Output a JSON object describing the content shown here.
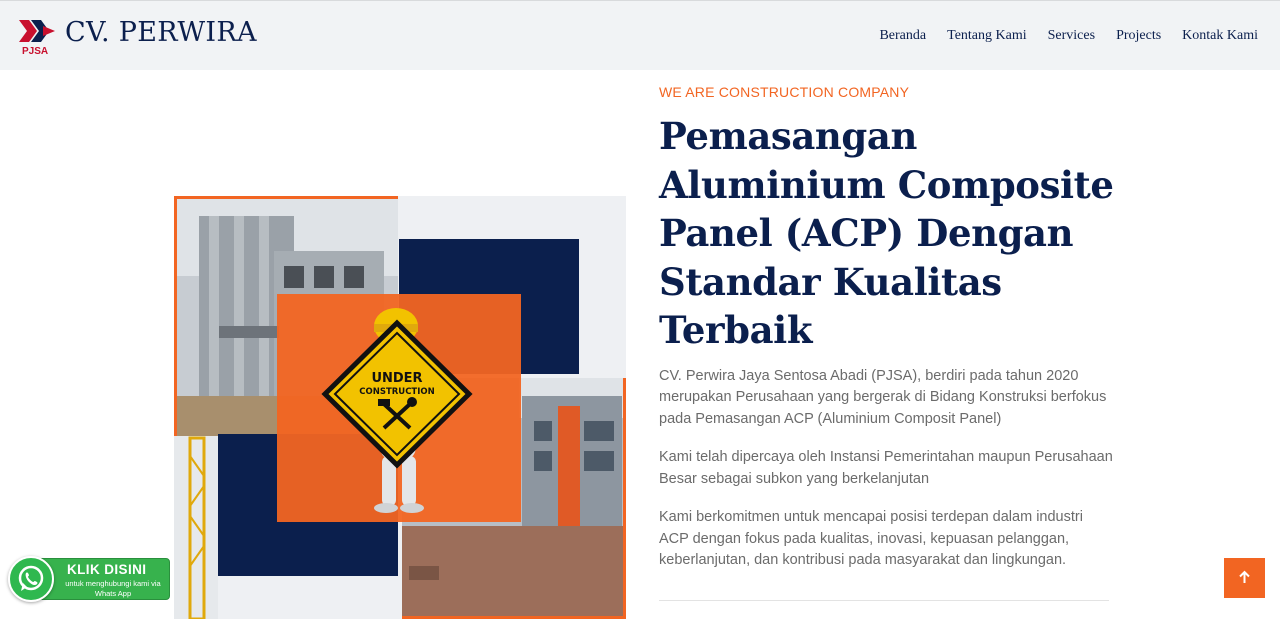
{
  "brand": {
    "logo_label": "PJSA",
    "name": "CV. PERWIRA"
  },
  "nav": {
    "items": [
      "Beranda",
      "Tentang Kami",
      "Services",
      "Projects",
      "Kontak Kami"
    ]
  },
  "hero": {
    "eyebrow": "WE ARE CONSTRUCTION COMPANY",
    "headline": "Pemasangan Aluminium Composite Panel (ACP) Dengan Standar Kualitas Terbaik",
    "paragraphs": [
      "CV. Perwira Jaya Sentosa Abadi (PJSA), berdiri pada tahun 2020 merupakan Perusahaan yang bergerak di Bidang Konstruksi berfokus pada Pemasangan ACP (Aluminium Composit Panel)",
      "Kami telah dipercaya oleh Instansi Pemerintahan maupun Perusahaan Besar sebagai subkon yang berkelanjutan",
      "Kami berkomitmen untuk mencapai posisi terdepan dalam industri ACP dengan fokus pada kualitas, inovasi, kepuasan pelanggan, keberlanjutan, dan kontribusi pada masyarakat dan lingkungan."
    ],
    "image_sign": {
      "line1": "UNDER",
      "line2": "CONSTRUCTION"
    }
  },
  "whatsapp": {
    "title": "KLIK DISINI",
    "subtitle": "untuk menghubungi kami via Whats App",
    "icon": "whatsapp-icon"
  },
  "back_to_top": {
    "icon": "arrow-up-icon"
  },
  "colors": {
    "navy": "#0b1f4d",
    "accent": "#f26522",
    "whatsapp_green": "#37b24d",
    "navbar_bg": "#f1f3f5"
  }
}
